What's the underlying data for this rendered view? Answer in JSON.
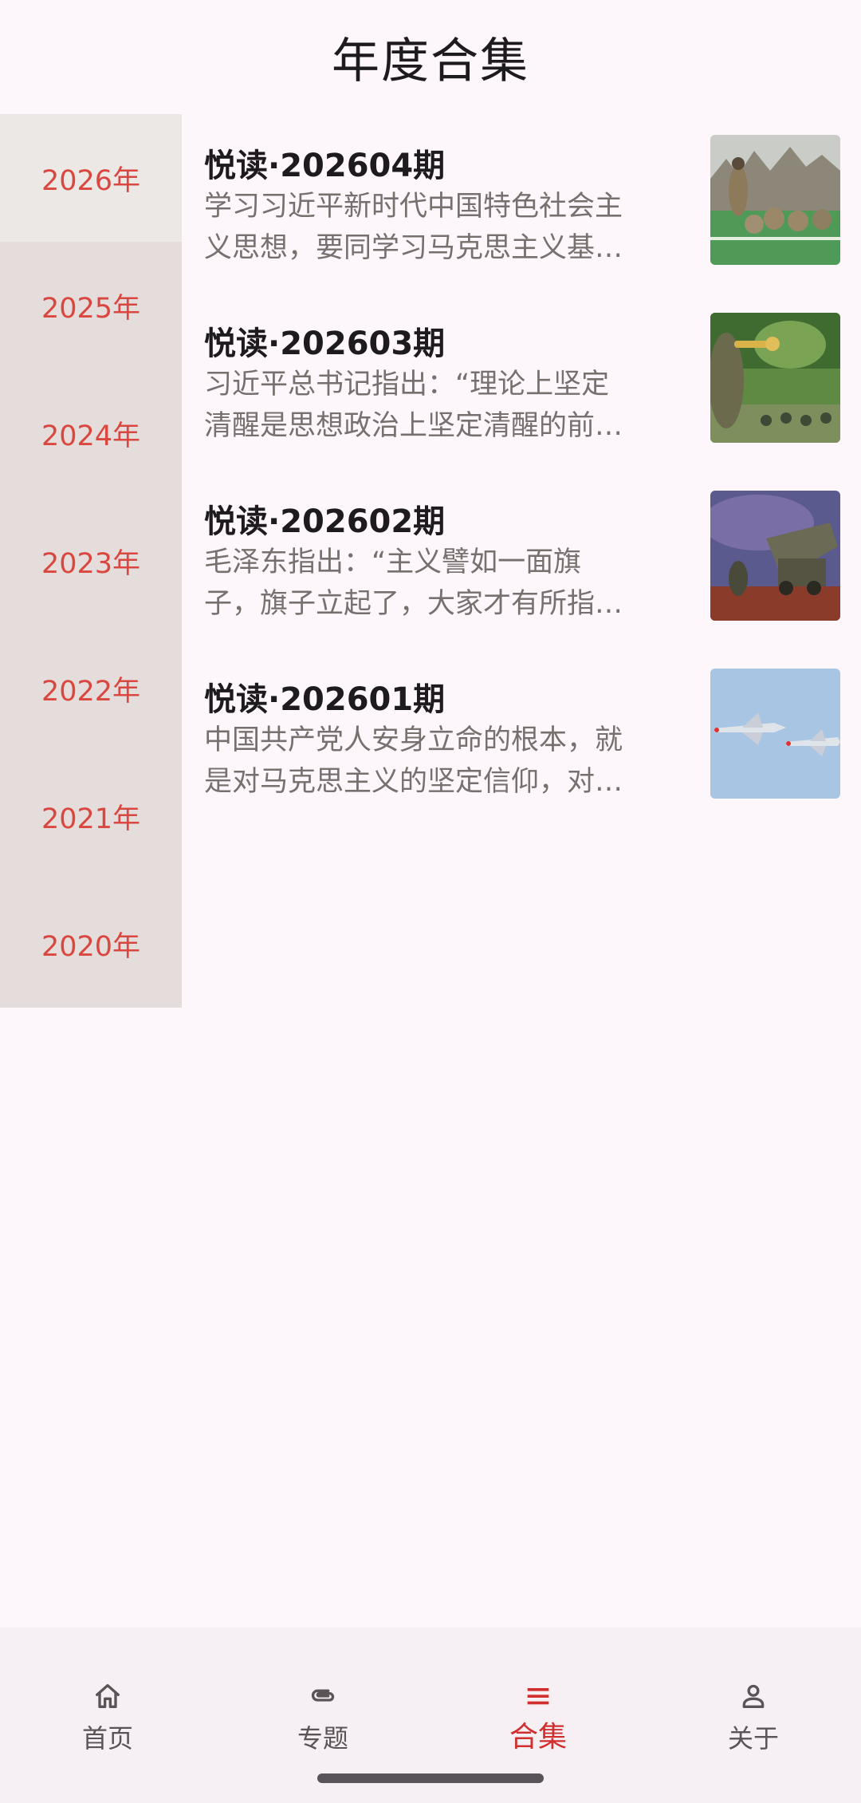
{
  "header": {
    "title": "年度合集"
  },
  "years": [
    "2026年",
    "2025年",
    "2024年",
    "2023年",
    "2022年",
    "2021年",
    "2020年"
  ],
  "selected_year": "2026年",
  "issues": [
    {
      "title": "悦读·202604期",
      "summary": "学习习近平新时代中国特色社会主义思想，要同学习马克思主义基…",
      "image": "soldiers-outdoor-training-photo"
    },
    {
      "title": "悦读·202603期",
      "summary": "习近平总书记指出：“理论上坚定清醒是思想政治上坚定清醒的前…",
      "image": "bugler-and-marching-troops-photo"
    },
    {
      "title": "悦读·202602期",
      "summary": "毛泽东指出：“主义譬如一面旗子，旗子立起了，大家才有所指…",
      "image": "missile-vehicle-and-soldiers-photo"
    },
    {
      "title": "悦读·202601期",
      "summary": "中国共产党人安身立命的根本，就是对马克思主义的坚定信仰，对…",
      "image": "fighter-jets-in-flight-photo"
    }
  ],
  "nav": {
    "items": [
      {
        "label": "首页",
        "icon": "home-icon"
      },
      {
        "label": "专题",
        "icon": "paperclip-icon"
      },
      {
        "label": "合集",
        "icon": "menu-icon"
      },
      {
        "label": "关于",
        "icon": "person-icon"
      }
    ],
    "active": "合集"
  },
  "colors": {
    "accent": "#d12f2f",
    "year_text": "#d9473f",
    "sidebar": "#e5dcdc",
    "background": "#fdf6fa"
  }
}
